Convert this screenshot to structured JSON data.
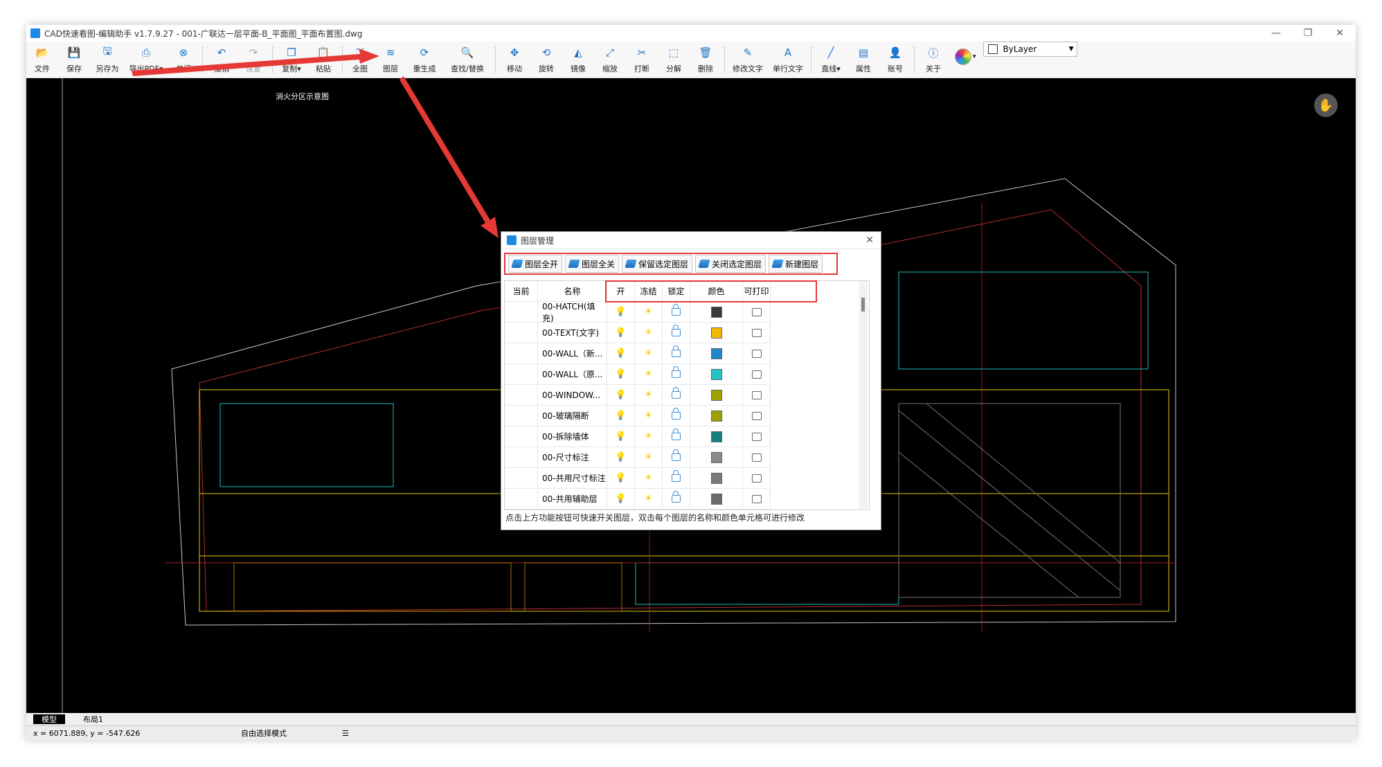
{
  "window": {
    "title": "CAD快速看图-编辑助手 v1.7.9.27 - 001-广联达一层平面-B_平面图_平面布置图.dwg",
    "min_icon": "minimize-icon",
    "max_icon": "restore-icon",
    "close_icon": "close-icon"
  },
  "toolbar": {
    "buttons": [
      {
        "name": "file",
        "label": "文件",
        "icon": "📂"
      },
      {
        "name": "save",
        "label": "保存",
        "icon": "💾"
      },
      {
        "name": "save-as",
        "label": "另存为",
        "icon": "🖫"
      },
      {
        "name": "export-pdf",
        "label": "导出PDF▾",
        "icon": "⎙"
      },
      {
        "name": "close-file",
        "label": "关闭",
        "icon": "⊗"
      },
      {
        "name": "undo",
        "label": "撤销",
        "icon": "↶"
      },
      {
        "name": "redo",
        "label": "恢复",
        "icon": "↷",
        "dim": true
      },
      {
        "name": "copy",
        "label": "复制▾",
        "icon": "❐"
      },
      {
        "name": "paste",
        "label": "粘贴",
        "icon": "📋"
      },
      {
        "name": "fit-all",
        "label": "全图",
        "icon": "⛶"
      },
      {
        "name": "layers",
        "label": "图层",
        "icon": "≋"
      },
      {
        "name": "regen",
        "label": "重生成",
        "icon": "⟳"
      },
      {
        "name": "find-replace",
        "label": "查找/替换",
        "icon": "🔍"
      },
      {
        "name": "move",
        "label": "移动",
        "icon": "✥"
      },
      {
        "name": "rotate",
        "label": "旋转",
        "icon": "⟲"
      },
      {
        "name": "mirror",
        "label": "镜像",
        "icon": "◭"
      },
      {
        "name": "scale",
        "label": "缩放",
        "icon": "⤢"
      },
      {
        "name": "break",
        "label": "打断",
        "icon": "✂"
      },
      {
        "name": "explode",
        "label": "分解",
        "icon": "⬚"
      },
      {
        "name": "delete",
        "label": "删除",
        "icon": "🗑"
      },
      {
        "name": "edit-text",
        "label": "修改文字",
        "icon": "✎"
      },
      {
        "name": "single-text",
        "label": "单行文字",
        "icon": "A"
      },
      {
        "name": "line",
        "label": "直线▾",
        "icon": "╱"
      },
      {
        "name": "properties",
        "label": "属性",
        "icon": "▤"
      },
      {
        "name": "account",
        "label": "账号",
        "icon": "👤"
      },
      {
        "name": "about",
        "label": "关于",
        "icon": "ⓘ"
      }
    ],
    "bylayer": "ByLayer"
  },
  "dialog": {
    "title": "图层管理",
    "buttons": [
      "图层全开",
      "图层全关",
      "保留选定图层",
      "关闭选定图层",
      "新建图层"
    ],
    "columns": [
      "当前",
      "名称",
      "开",
      "冻结",
      "锁定",
      "颜色",
      "可打印"
    ],
    "layers": [
      {
        "name": "00-HATCH(填充)",
        "color": "#3a3a3a"
      },
      {
        "name": "00-TEXT(文字)",
        "color": "#f5b800"
      },
      {
        "name": "00-WALL（新...",
        "color": "#1e88c8"
      },
      {
        "name": "00-WALL（原...",
        "color": "#22c4c8"
      },
      {
        "name": "00-WINDOW...",
        "color": "#a0a000"
      },
      {
        "name": "00-玻璃隔断",
        "color": "#a0a000"
      },
      {
        "name": "00-拆除墙体",
        "color": "#138080"
      },
      {
        "name": "00-尺寸标注",
        "color": "#8a8a8a"
      },
      {
        "name": "00-共用尺寸标注",
        "color": "#7a7a7a"
      },
      {
        "name": "00-共用辅助层",
        "color": "#6a6a6a"
      }
    ],
    "hint": "点击上方功能按钮可快速开关图层，双击每个图层的名称和颜色单元格可进行修改"
  },
  "tabs": [
    "模型",
    "布局1"
  ],
  "status": {
    "coords": "x = 6071.889, y = -547.626",
    "mode": "自由选择模式"
  },
  "canvas_label": "消火分区示意图"
}
